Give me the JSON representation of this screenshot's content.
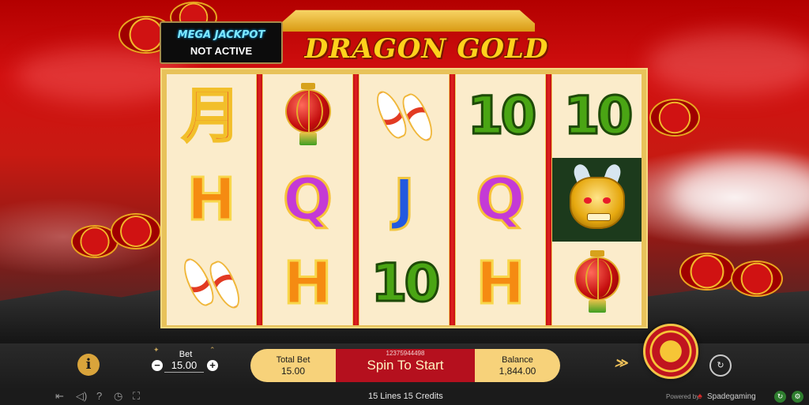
{
  "game": {
    "title": "DRAGON GOLD"
  },
  "jackpot": {
    "title": "MEGA JACKPOT",
    "status": "NOT ACTIVE"
  },
  "reels": [
    [
      "A",
      "K",
      "koi"
    ],
    [
      "lantern",
      "Q",
      "K"
    ],
    [
      "koi",
      "J",
      "10"
    ],
    [
      "10",
      "Q",
      "K"
    ],
    [
      "10",
      "dragon",
      "lantern"
    ]
  ],
  "symbols": {
    "A": "月",
    "K": "H",
    "Q": "Q",
    "J": "J",
    "10": "10"
  },
  "bet": {
    "label": "Bet",
    "value": "15.00",
    "minus": "−",
    "plus": "+"
  },
  "info": {
    "icon": "i"
  },
  "controls": {
    "total_bet_label": "Total Bet",
    "total_bet_value": "15.00",
    "spin_id": "12375944498",
    "spin_label": "Spin To Start",
    "balance_label": "Balance",
    "balance_value": "1,844.00"
  },
  "footer": {
    "lines_text": "15 Lines  15 Credits",
    "powered_by": "Powered by",
    "brand": "Spadegaming"
  },
  "colors": {
    "accent_gold": "#f2c446",
    "spin_red": "#b5101e",
    "jackpot_cyan": "#7ee8ff"
  }
}
